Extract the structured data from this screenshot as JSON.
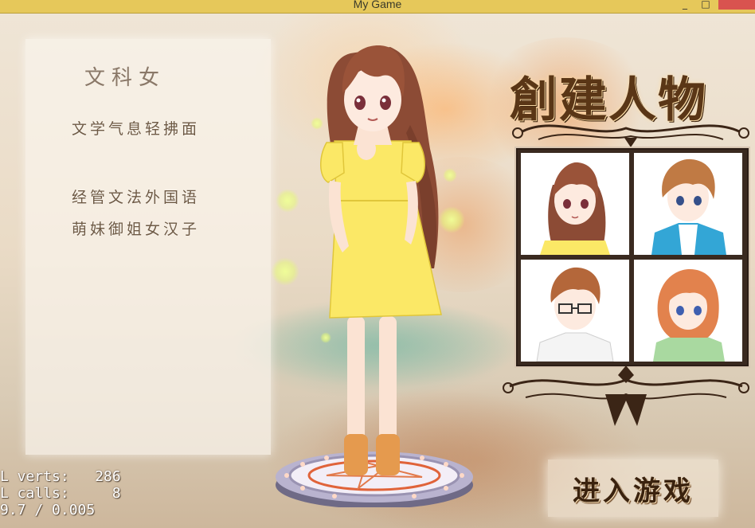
{
  "window": {
    "title": "My Game"
  },
  "info_panel": {
    "class_name": "文科女",
    "lines": [
      "文学气息轻拂面",
      "经管文法外国语",
      "萌妹御姐女汉子"
    ]
  },
  "title_text": "創建人物",
  "portraits": [
    {
      "name": "portrait-girl-long-brown-hair",
      "selected": true
    },
    {
      "name": "portrait-boy-blue-jacket",
      "selected": false
    },
    {
      "name": "portrait-boy-glasses",
      "selected": false
    },
    {
      "name": "portrait-girl-short-orange-hair",
      "selected": false
    }
  ],
  "enter_button": {
    "label": "进入游戏"
  },
  "stats": {
    "verts": "L verts:   286",
    "calls": "L calls:     8",
    "fps": "9.7 / 0.005"
  }
}
